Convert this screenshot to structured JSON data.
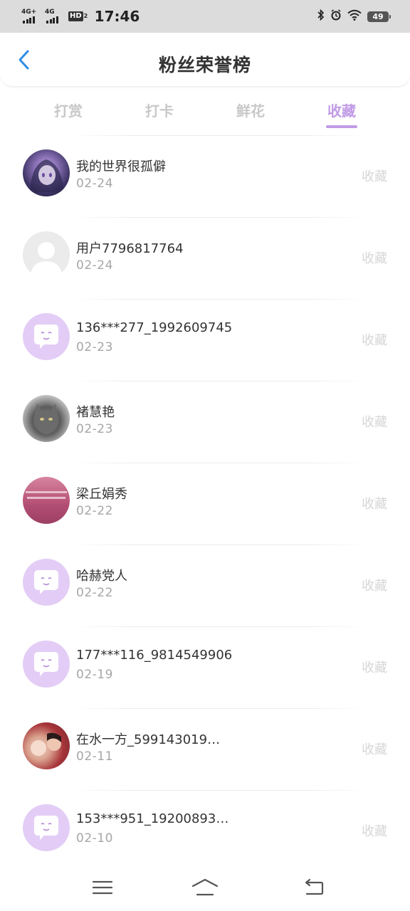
{
  "status_bar": {
    "signal_1_label": "4G+",
    "signal_2_label": "4G",
    "hd_label": "HD",
    "hd_number": "2",
    "time": "17:46",
    "battery": "49"
  },
  "header": {
    "title": "粉丝荣誉榜"
  },
  "tabs": [
    {
      "label": "打赏",
      "active": false
    },
    {
      "label": "打卡",
      "active": false
    },
    {
      "label": "鲜花",
      "active": false
    },
    {
      "label": "收藏",
      "active": true
    }
  ],
  "colors": {
    "accent": "#c19be6",
    "back_arrow": "#2f8ee6",
    "bubble_avatar": "#e3cdf6"
  },
  "list": [
    {
      "name": "我的世界很孤僻",
      "date": "02-24",
      "tag": "收藏",
      "avatar": "anime-avatar"
    },
    {
      "name": "用户7796817764",
      "date": "02-24",
      "tag": "收藏",
      "avatar": "default-avatar"
    },
    {
      "name": "136***277_1992609745",
      "date": "02-23",
      "tag": "收藏",
      "avatar": "chat-bubble-avatar"
    },
    {
      "name": "褚慧艳",
      "date": "02-23",
      "tag": "收藏",
      "avatar": "cat-avatar"
    },
    {
      "name": "梁丘娟秀",
      "date": "02-22",
      "tag": "收藏",
      "avatar": "pink-avatar"
    },
    {
      "name": "哈赫党人",
      "date": "02-22",
      "tag": "收藏",
      "avatar": "chat-bubble-avatar"
    },
    {
      "name": "177***116_9814549906",
      "date": "02-19",
      "tag": "收藏",
      "avatar": "chat-bubble-avatar"
    },
    {
      "name": "在水一方_599143019…",
      "date": "02-11",
      "tag": "收藏",
      "avatar": "photo-avatar"
    },
    {
      "name": "153***951_19200893…",
      "date": "02-10",
      "tag": "收藏",
      "avatar": "chat-bubble-avatar"
    }
  ],
  "bottom_nav": {
    "menu_icon": "menu-icon",
    "home_icon": "home-icon",
    "back_icon": "back-icon"
  }
}
